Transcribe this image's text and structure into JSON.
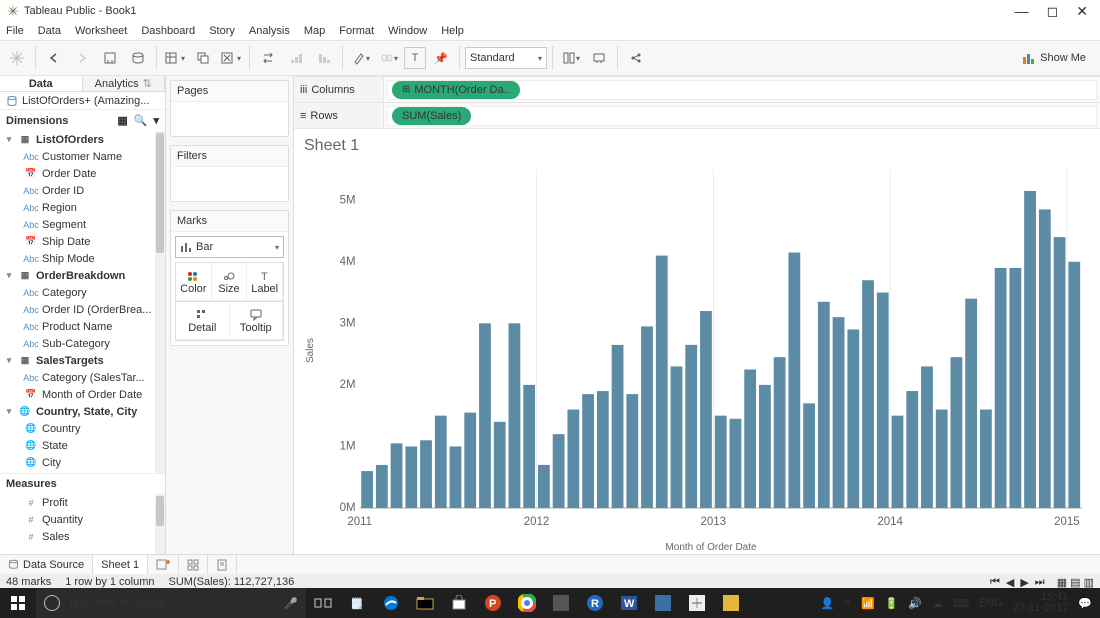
{
  "title": "Tableau Public - Book1",
  "menu": [
    "File",
    "Data",
    "Worksheet",
    "Dashboard",
    "Story",
    "Analysis",
    "Map",
    "Format",
    "Window",
    "Help"
  ],
  "toolbar": {
    "fit_dropdown": "Standard",
    "showme": "Show Me"
  },
  "side": {
    "tab_data": "Data",
    "tab_analytics": "Analytics",
    "datasource": "ListOfOrders+ (Amazing...",
    "dim_hdr": "Dimensions",
    "meas_hdr": "Measures",
    "tables": [
      {
        "name": "ListOfOrders",
        "fields": [
          {
            "t": "abc",
            "n": "Customer Name"
          },
          {
            "t": "date",
            "n": "Order Date"
          },
          {
            "t": "abc",
            "n": "Order ID"
          },
          {
            "t": "abc",
            "n": "Region"
          },
          {
            "t": "abc",
            "n": "Segment"
          },
          {
            "t": "date",
            "n": "Ship Date"
          },
          {
            "t": "abc",
            "n": "Ship Mode"
          }
        ]
      },
      {
        "name": "OrderBreakdown",
        "fields": [
          {
            "t": "abc",
            "n": "Category"
          },
          {
            "t": "abc",
            "n": "Order ID (OrderBrea..."
          },
          {
            "t": "abc",
            "n": "Product Name"
          },
          {
            "t": "abc",
            "n": "Sub-Category"
          }
        ]
      },
      {
        "name": "SalesTargets",
        "fields": [
          {
            "t": "abc",
            "n": "Category (SalesTar..."
          },
          {
            "t": "date",
            "n": "Month of Order Date"
          }
        ]
      },
      {
        "name": "Country, State, City",
        "geo": true,
        "fields": [
          {
            "t": "geo",
            "n": "Country"
          },
          {
            "t": "geo",
            "n": "State"
          },
          {
            "t": "geo",
            "n": "City"
          }
        ]
      }
    ],
    "measures": [
      {
        "t": "num",
        "n": "Profit"
      },
      {
        "t": "num",
        "n": "Quantity"
      },
      {
        "t": "num",
        "n": "Sales"
      }
    ]
  },
  "mid": {
    "pages": "Pages",
    "filters": "Filters",
    "marks": "Marks",
    "mark_type": "Bar",
    "cells": [
      "Color",
      "Size",
      "Label",
      "Detail",
      "Tooltip"
    ]
  },
  "shelves": {
    "columns_lbl": "Columns",
    "rows_lbl": "Rows",
    "col_pill": "MONTH(Order Da..",
    "row_pill": "SUM(Sales)"
  },
  "sheet_title": "Sheet 1",
  "chart_data": {
    "type": "bar",
    "title": "Sheet 1",
    "ylabel": "Sales",
    "xlabel": "Month of Order Date",
    "ylim": [
      0,
      5500000
    ],
    "yticks": [
      "0M",
      "1M",
      "2M",
      "3M",
      "4M",
      "5M"
    ],
    "year_ticks": [
      2011,
      2012,
      2013,
      2014,
      2015
    ],
    "categories": [
      "2011-01",
      "2011-02",
      "2011-03",
      "2011-04",
      "2011-05",
      "2011-06",
      "2011-07",
      "2011-08",
      "2011-09",
      "2011-10",
      "2011-11",
      "2011-12",
      "2012-01",
      "2012-02",
      "2012-03",
      "2012-04",
      "2012-05",
      "2012-06",
      "2012-07",
      "2012-08",
      "2012-09",
      "2012-10",
      "2012-11",
      "2012-12",
      "2013-01",
      "2013-02",
      "2013-03",
      "2013-04",
      "2013-05",
      "2013-06",
      "2013-07",
      "2013-08",
      "2013-09",
      "2013-10",
      "2013-11",
      "2013-12",
      "2014-01",
      "2014-02",
      "2014-03",
      "2014-04",
      "2014-05",
      "2014-06",
      "2014-07",
      "2014-08",
      "2014-09",
      "2014-10",
      "2014-11",
      "2014-12"
    ],
    "values": [
      600000,
      700000,
      1050000,
      1000000,
      1100000,
      1500000,
      1000000,
      1550000,
      3000000,
      1400000,
      3000000,
      2000000,
      700000,
      1200000,
      1600000,
      1850000,
      1900000,
      2650000,
      1850000,
      2950000,
      4100000,
      2300000,
      2650000,
      3200000,
      1500000,
      1450000,
      2250000,
      2000000,
      2450000,
      4150000,
      1700000,
      3350000,
      3100000,
      2900000,
      3700000,
      3500000,
      1500000,
      1900000,
      2300000,
      1600000,
      2450000,
      3400000,
      1600000,
      3900000,
      3900000,
      5150000,
      4850000,
      4400000,
      4000000
    ]
  },
  "bottom": {
    "data_source": "Data Source",
    "sheet": "Sheet 1"
  },
  "status": {
    "marks": "48 marks",
    "rows": "1 row by 1 column",
    "sum": "SUM(Sales): 112,727,136"
  },
  "taskbar": {
    "search_placeholder": "Type here to search",
    "lang": "ENG",
    "time": "15:41",
    "date": "27-11-2017"
  }
}
